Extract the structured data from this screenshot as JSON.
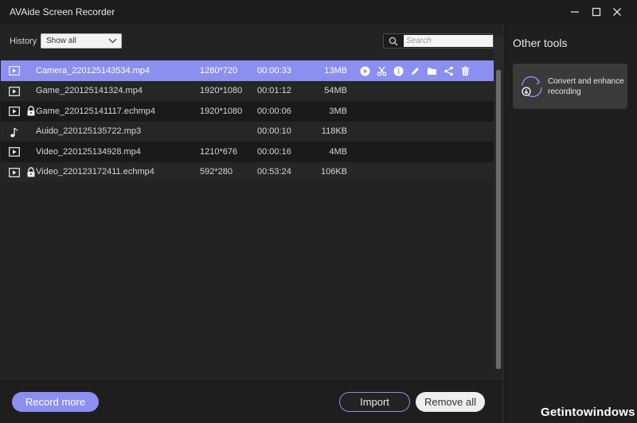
{
  "window": {
    "title": "AVAide Screen Recorder"
  },
  "toolbar": {
    "history_label": "History",
    "history_selected": "Show all",
    "search_placeholder": "Search"
  },
  "recordings": [
    {
      "type": "video",
      "locked": false,
      "name": "Camera_220125143534.mp4",
      "resolution": "1280*720",
      "duration": "00:00:33",
      "size": "13MB",
      "selected": true
    },
    {
      "type": "video",
      "locked": false,
      "name": "Game_220125141324.mp4",
      "resolution": "1920*1080",
      "duration": "00:01:12",
      "size": "54MB",
      "selected": false
    },
    {
      "type": "video",
      "locked": true,
      "name": "Game_220125141117.echmp4",
      "resolution": "1920*1080",
      "duration": "00:00:06",
      "size": "3MB",
      "selected": false
    },
    {
      "type": "audio",
      "locked": false,
      "name": "Auido_220125135722.mp3",
      "resolution": "",
      "duration": "00:00:10",
      "size": "118KB",
      "selected": false
    },
    {
      "type": "video",
      "locked": false,
      "name": "Video_220125134928.mp4",
      "resolution": "1210*676",
      "duration": "00:00:16",
      "size": "4MB",
      "selected": false
    },
    {
      "type": "video",
      "locked": true,
      "name": "Video_220123172411.echmp4",
      "resolution": "592*280",
      "duration": "00:53:24",
      "size": "106KB",
      "selected": false
    }
  ],
  "row_actions": [
    "play-icon",
    "scissors-icon",
    "info-icon",
    "pencil-icon",
    "folder-icon",
    "share-icon",
    "trash-icon"
  ],
  "footer": {
    "record_more": "Record more",
    "import": "Import",
    "remove_all": "Remove all"
  },
  "sidebar": {
    "title": "Other tools",
    "tools": [
      {
        "label": "Convert and enhance recording",
        "icon": "convert-icon"
      }
    ]
  },
  "watermark": "Getintowindows",
  "colors": {
    "accent": "#8b8ff0",
    "background": "#222222",
    "row_dark": "#1a1a1a",
    "row_light": "#262626",
    "sidebar_card": "#3a3a3a"
  }
}
